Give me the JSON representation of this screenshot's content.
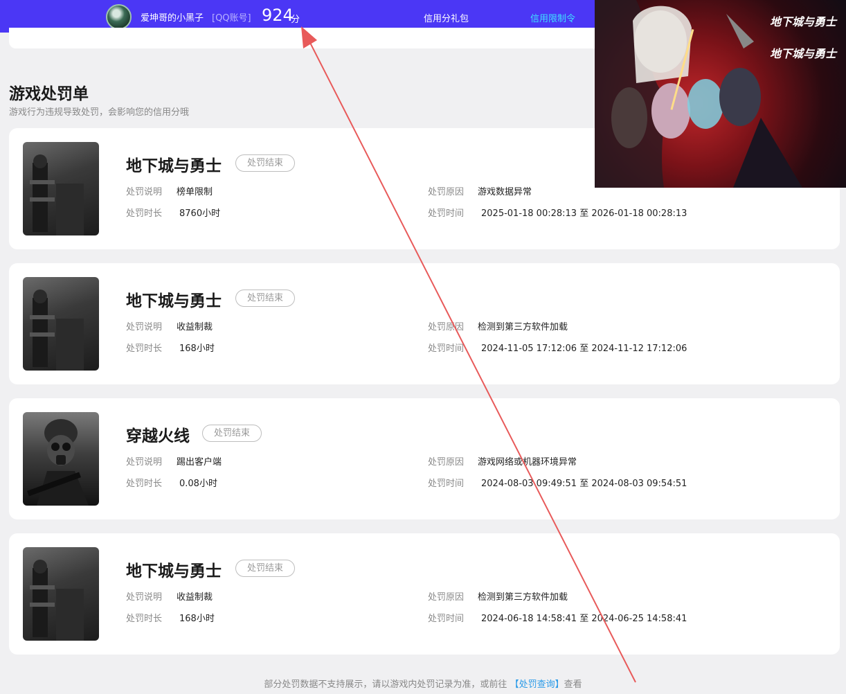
{
  "header": {
    "username": "爱坤哥的小黑子",
    "account_type": "[QQ账号]",
    "score": "924",
    "score_unit": "分",
    "nav": [
      "信用分礼包",
      "信用限制令"
    ]
  },
  "section": {
    "title": "游戏处罚单",
    "subtitle": "游戏行为违规导致处罚，会影响您的信用分哦"
  },
  "labels": {
    "desc": "处罚说明",
    "duration": "处罚时长",
    "reason": "处罚原因",
    "time": "处罚时间"
  },
  "cards": [
    {
      "game": "地下城与勇士",
      "status": "处罚结束",
      "desc": "榜单限制",
      "duration": "8760小时",
      "reason": "游戏数据异常",
      "time": "2025-01-18 00:28:13 至 2026-01-18 00:28:13"
    },
    {
      "game": "地下城与勇士",
      "status": "处罚结束",
      "desc": "收益制裁",
      "duration": "168小时",
      "reason": "检测到第三方软件加载",
      "time": "2024-11-05 17:12:06 至 2024-11-12 17:12:06"
    },
    {
      "game": "穿越火线",
      "status": "处罚结束",
      "desc": "踢出客户端",
      "duration": "0.08小时",
      "reason": "游戏网络或机器环境异常",
      "time": "2024-08-03 09:49:51 至 2024-08-03 09:54:51"
    },
    {
      "game": "地下城与勇士",
      "status": "处罚结束",
      "desc": "收益制裁",
      "duration": "168小时",
      "reason": "检测到第三方软件加载",
      "time": "2024-06-18 14:58:41 至 2024-06-25 14:58:41"
    }
  ],
  "banner": {
    "logo_text": "地下城与勇士"
  },
  "footer": {
    "text_before": "部分处罚数据不支持展示，请以游戏内处罚记录为准，或前往",
    "link": "【处罚查询】",
    "text_after": "查看"
  },
  "colors": {
    "topbar": "#4b37f5",
    "active_nav": "#3fe0ff",
    "link": "#2b9be8",
    "arrow": "#e85a5a"
  }
}
